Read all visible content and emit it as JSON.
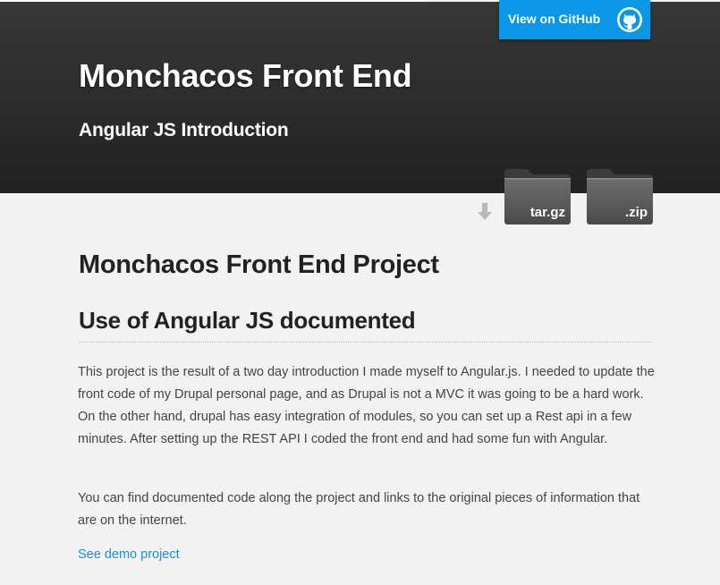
{
  "header": {
    "title": "Monchacos Front End",
    "subtitle": "Angular JS Introduction",
    "github_button": {
      "label": "View on GitHub",
      "icon": "github-octocat-icon",
      "color": "#0c96e6"
    }
  },
  "downloads": {
    "arrow_icon": "download-arrow-icon",
    "items": [
      {
        "label": "tar.gz",
        "icon": "folder-icon"
      },
      {
        "label": ".zip",
        "icon": "folder-icon"
      }
    ]
  },
  "main": {
    "heading": "Monchacos Front End Project",
    "subheading": "Use of Angular JS documented",
    "paragraphs": [
      "This project is the result of a two day introduction I made myself to Angular.js. I needed to update the front code of my Drupal personal page, and as Drupal is not a MVC it was going to be a hard work. On the other hand, drupal has easy integration of modules, so you can set up a Rest api in a few minutes. After setting up the REST API I coded the front end and had some fun with Angular.",
      "You can find documented code along the project and links to the original pieces of information that are on the internet."
    ],
    "link": {
      "label": "See demo project",
      "color": "#1a8fd6"
    }
  }
}
